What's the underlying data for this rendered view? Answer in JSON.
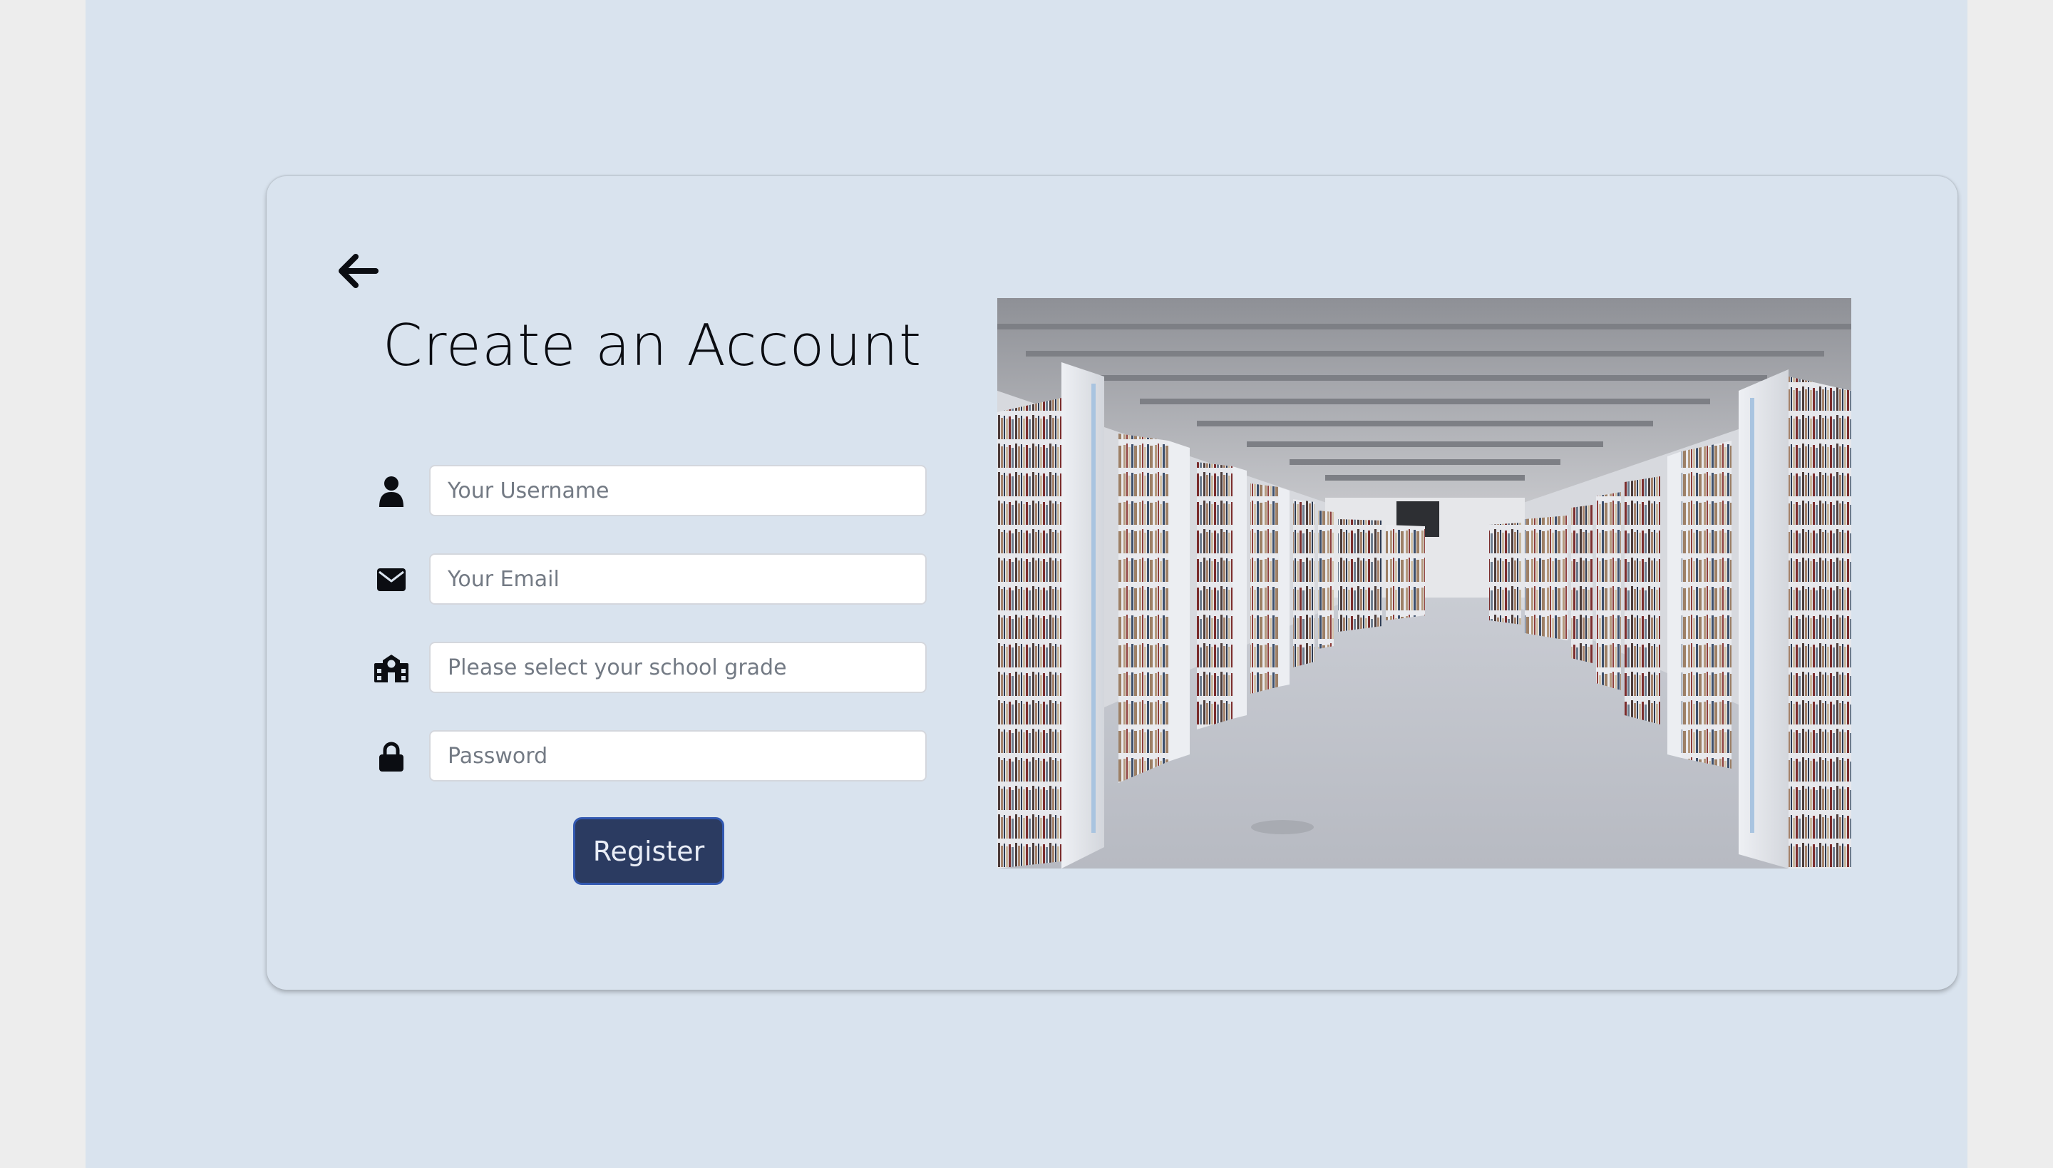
{
  "form": {
    "title": "Create an Account",
    "fields": [
      {
        "icon": "user-icon",
        "placeholder": "Your Username",
        "value": ""
      },
      {
        "icon": "envelope-icon",
        "placeholder": "Your Email",
        "value": ""
      },
      {
        "icon": "school-icon",
        "placeholder": "Please select your school grade",
        "value": ""
      },
      {
        "icon": "lock-icon",
        "placeholder": "Password",
        "value": ""
      }
    ],
    "register_label": "Register"
  },
  "navigation": {
    "back_icon": "arrow-left-icon"
  },
  "image": {
    "subject": "library-bookshelves-image"
  },
  "colors": {
    "page_background": "#d9e3ee",
    "outer_background": "#ededed",
    "button_background": "#2b3b61",
    "button_border": "#3258b0",
    "button_text": "#e9edf6",
    "title_text": "#0b0d12"
  }
}
